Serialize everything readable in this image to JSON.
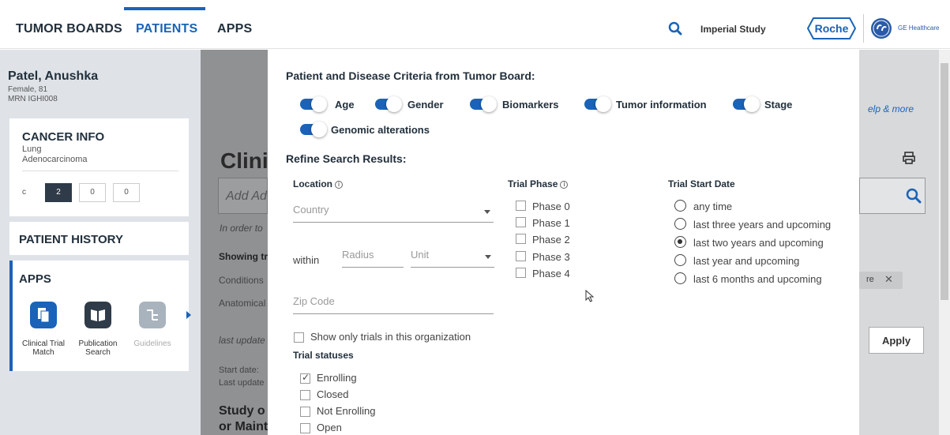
{
  "nav": {
    "tabs": [
      {
        "label": "TUMOR BOARDS"
      },
      {
        "label": "PATIENTS"
      },
      {
        "label": "APPS"
      }
    ],
    "active_tab": "PATIENTS",
    "study": "Imperial Study",
    "brand_logo": "Roche",
    "partner_label": "GE Healthcare",
    "accent_color": "#1a63b8"
  },
  "patient": {
    "name": "Patel, Anushka",
    "demographics": "Female, 81",
    "mrn": "MRN IGHI008"
  },
  "sidebar": {
    "cancer_info_title": "CANCER INFO",
    "cancer_type": "Lung",
    "histology": "Adenocarcinoma",
    "stage_prefix": "c",
    "stage_values": [
      "2",
      "0",
      "0"
    ],
    "patient_history_title": "PATIENT HISTORY",
    "apps_title": "APPS",
    "apps": [
      {
        "label": "Clinical Trial Match",
        "icon": "clinical-trial-icon"
      },
      {
        "label": "Publication Search",
        "icon": "book-icon"
      },
      {
        "label": "Guidelines",
        "icon": "guidelines-icon"
      }
    ]
  },
  "background": {
    "title_partial": "Clini",
    "search_placeholder_partial": "Add Ad",
    "hint_partial": "In order to",
    "showing_partial": "Showing tr",
    "conditions_partial": "Conditions",
    "anatomical_partial": "Anatomical",
    "last_update_partial": "last update",
    "start_date_partial": "Start date:",
    "last_updated_partial": "Last update",
    "study_partial_1": "Study o",
    "study_partial_2": "or Maint",
    "help_partial": "elp & more",
    "chip_partial": "re",
    "apply_label": "Apply"
  },
  "modal": {
    "criteria_title": "Patient and Disease Criteria from Tumor Board:",
    "criteria_toggles": [
      {
        "label": "Age",
        "on": true
      },
      {
        "label": "Gender",
        "on": true
      },
      {
        "label": "Biomarkers",
        "on": true
      },
      {
        "label": "Tumor information",
        "on": true
      },
      {
        "label": "Stage",
        "on": true
      },
      {
        "label": "Genomic alterations",
        "on": true
      }
    ],
    "refine_title": "Refine Search Results:",
    "location_label": "Location",
    "country_placeholder": "Country",
    "within_label": "within",
    "radius_placeholder": "Radius",
    "unit_placeholder": "Unit",
    "zip_placeholder": "Zip Code",
    "org_only_label": "Show only trials in this organization",
    "org_only_checked": false,
    "trial_phase_label": "Trial Phase",
    "phases": [
      {
        "label": "Phase 0",
        "checked": false
      },
      {
        "label": "Phase 1",
        "checked": false
      },
      {
        "label": "Phase 2",
        "checked": false
      },
      {
        "label": "Phase 3",
        "checked": false
      },
      {
        "label": "Phase 4",
        "checked": false
      }
    ],
    "start_date_label": "Trial Start Date",
    "start_date_options": [
      {
        "label": "any time",
        "selected": false
      },
      {
        "label": "last three years and upcoming",
        "selected": false
      },
      {
        "label": "last two years and upcoming",
        "selected": true
      },
      {
        "label": "last year and upcoming",
        "selected": false
      },
      {
        "label": "last 6 months and upcoming",
        "selected": false
      }
    ],
    "statuses_label": "Trial statuses",
    "statuses": [
      {
        "label": "Enrolling",
        "checked": true
      },
      {
        "label": "Closed",
        "checked": false
      },
      {
        "label": "Not Enrolling",
        "checked": false
      },
      {
        "label": "Open",
        "checked": false
      }
    ]
  }
}
